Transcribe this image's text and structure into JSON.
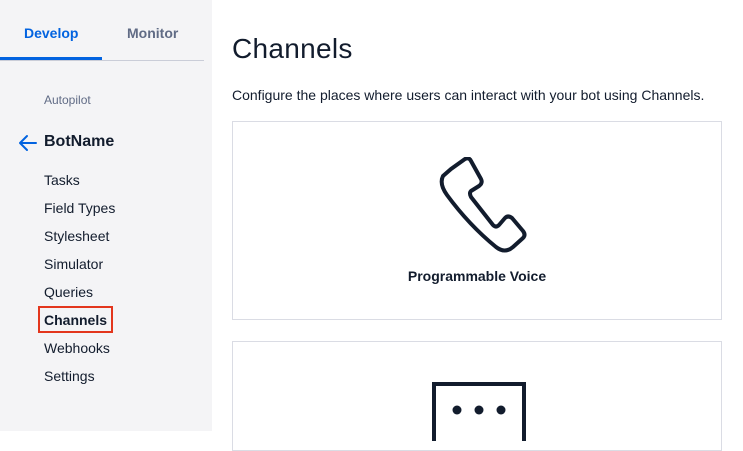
{
  "sidebar": {
    "tabs": [
      {
        "label": "Develop",
        "active": true
      },
      {
        "label": "Monitor",
        "active": false
      }
    ],
    "section_label": "Autopilot",
    "bot_name": "BotName",
    "items": [
      {
        "label": "Tasks"
      },
      {
        "label": "Field Types"
      },
      {
        "label": "Stylesheet"
      },
      {
        "label": "Simulator"
      },
      {
        "label": "Queries"
      },
      {
        "label": "Channels",
        "active": true
      },
      {
        "label": "Webhooks"
      },
      {
        "label": "Settings"
      }
    ]
  },
  "main": {
    "title": "Channels",
    "description": "Configure the places where users can interact with your bot using Channels.",
    "cards": [
      {
        "label": "Programmable Voice",
        "icon": "phone-icon"
      },
      {
        "label": "",
        "icon": "chat-icon"
      }
    ]
  },
  "colors": {
    "accent": "#0263e0",
    "highlight": "#e3361d",
    "sidebar_bg": "#f4f4f6",
    "text": "#121c2d"
  }
}
